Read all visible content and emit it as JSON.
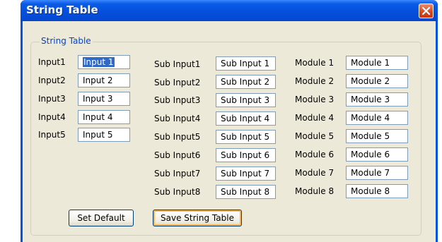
{
  "window": {
    "title": "String Table"
  },
  "group": {
    "legend": "String Table"
  },
  "inputs": [
    {
      "label": "Input1",
      "value": "Input 1"
    },
    {
      "label": "Input2",
      "value": "Input 2"
    },
    {
      "label": "Input3",
      "value": "Input 3"
    },
    {
      "label": "Input4",
      "value": "Input 4"
    },
    {
      "label": "Input5",
      "value": "Input 5"
    }
  ],
  "sub_inputs": [
    {
      "label": "Sub Input1",
      "value": "Sub Input 1"
    },
    {
      "label": "Sub Input2",
      "value": "Sub Input 2"
    },
    {
      "label": "Sub Input3",
      "value": "Sub Input 3"
    },
    {
      "label": "Sub Input4",
      "value": "Sub Input 4"
    },
    {
      "label": "Sub Input5",
      "value": "Sub Input 5"
    },
    {
      "label": "Sub Input6",
      "value": "Sub Input 6"
    },
    {
      "label": "Sub Input7",
      "value": "Sub Input 7"
    },
    {
      "label": "Sub Input8",
      "value": "Sub Input 8"
    }
  ],
  "modules": [
    {
      "label": "Module 1",
      "value": "Module 1"
    },
    {
      "label": "Module 2",
      "value": "Module 2"
    },
    {
      "label": "Module 3",
      "value": "Module 3"
    },
    {
      "label": "Module 4",
      "value": "Module 4"
    },
    {
      "label": "Module 5",
      "value": "Module 5"
    },
    {
      "label": "Module 6",
      "value": "Module 6"
    },
    {
      "label": "Module 7",
      "value": "Module 7"
    },
    {
      "label": "Module 8",
      "value": "Module 8"
    }
  ],
  "buttons": {
    "set_default": "Set Default",
    "save": "Save String Table"
  },
  "colors": {
    "title_bar": "#0a5be6",
    "dialog_bg": "#ece9d8",
    "legend_text": "#0046d5",
    "close_button": "#d9441c",
    "selection": "#316ac5"
  },
  "icons": {
    "close": "close-icon"
  }
}
